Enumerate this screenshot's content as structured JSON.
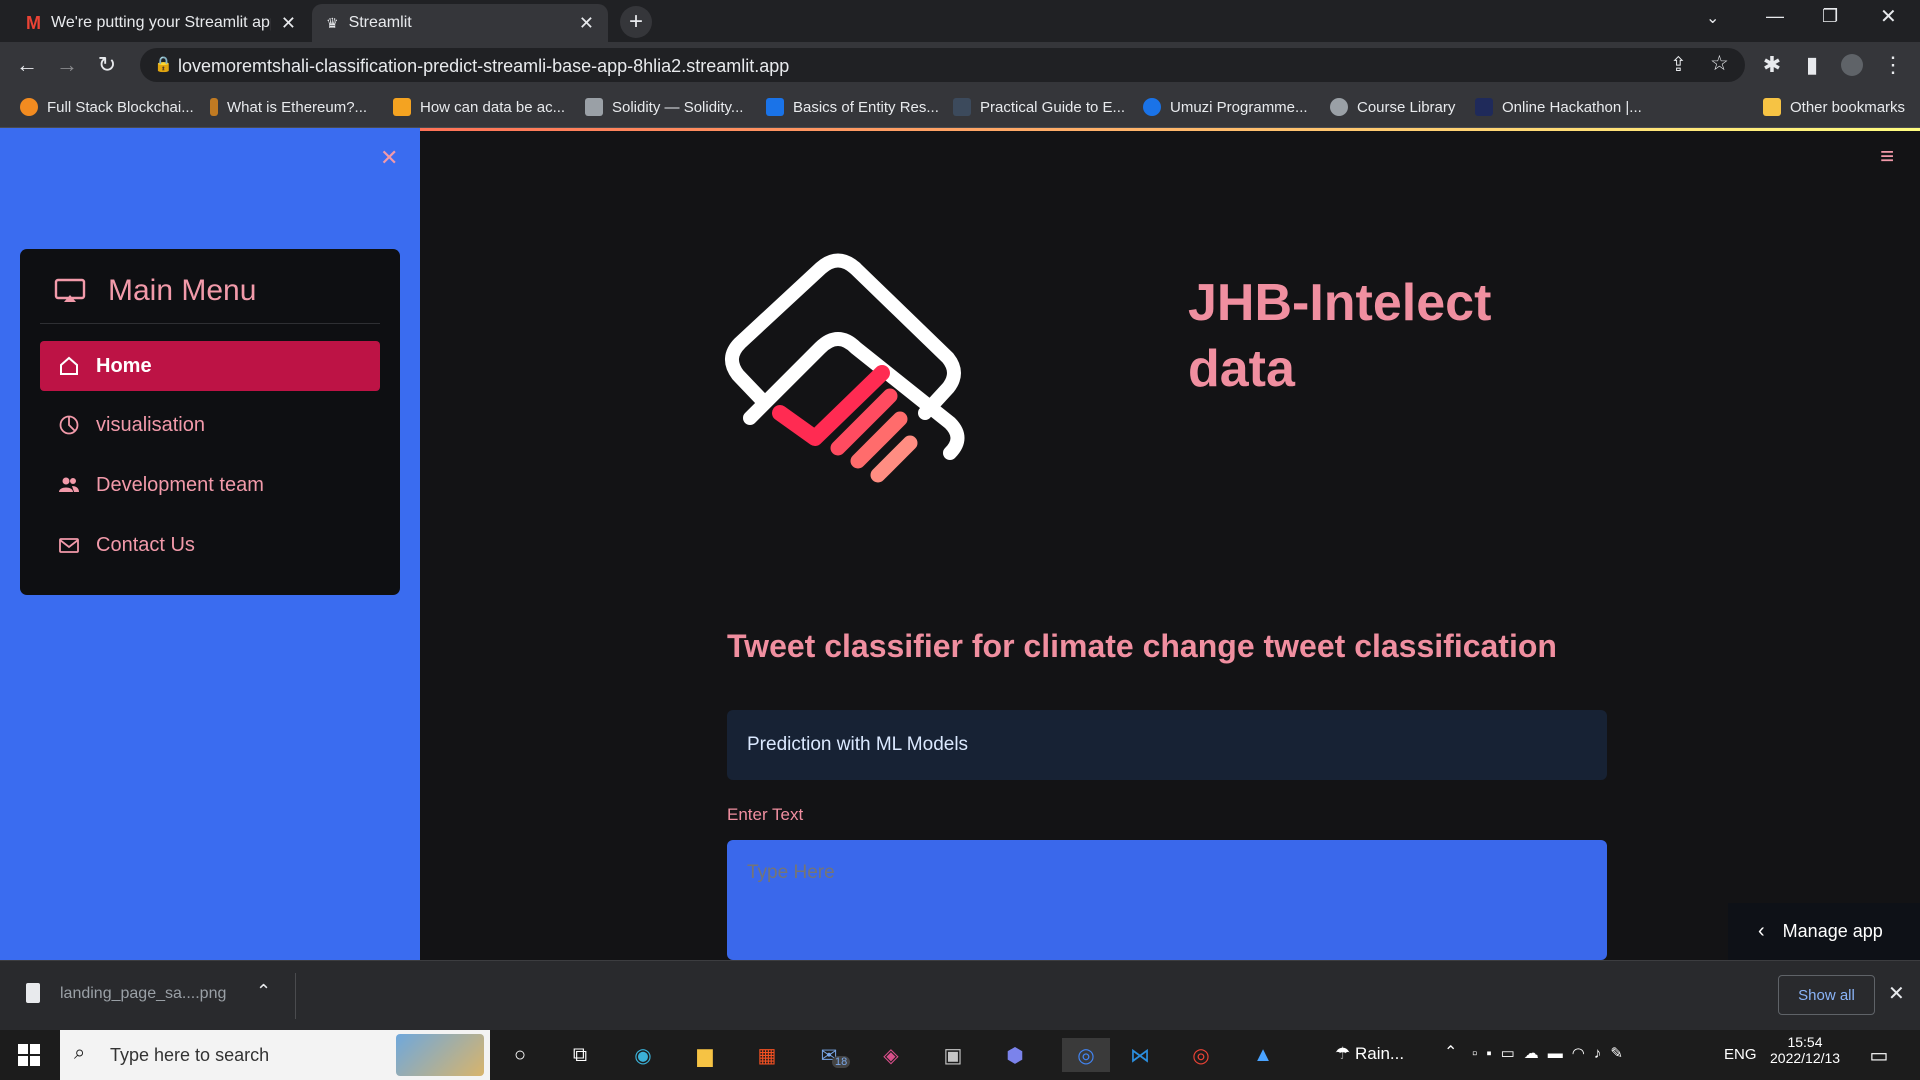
{
  "browser": {
    "tabs": [
      {
        "title": "We're putting your Streamlit app",
        "active": false
      },
      {
        "title": "Streamlit",
        "active": true
      }
    ],
    "url": "lovemoremtshali-classification-predict-streamli-base-app-8hlia2.streamlit.app",
    "bookmarks": [
      "Full Stack Blockchai...",
      "What is Ethereum?...",
      "How can data be ac...",
      "Solidity — Solidity...",
      "Basics of Entity Res...",
      "Practical Guide to E...",
      "Umuzi Programme...",
      "Course Library",
      "Online Hackathon |..."
    ],
    "other_bookmarks": "Other bookmarks"
  },
  "sidebar": {
    "menu_title": "Main Menu",
    "items": [
      {
        "label": "Home",
        "icon": "house-icon",
        "active": true
      },
      {
        "label": "visualisation",
        "icon": "pie-chart-icon",
        "active": false
      },
      {
        "label": "Development team",
        "icon": "people-icon",
        "active": false
      },
      {
        "label": "Contact Us",
        "icon": "envelope-icon",
        "active": false
      }
    ]
  },
  "main": {
    "title": "JHB-Intelect data",
    "title_line1": "JHB-Intelect",
    "title_line2": "data",
    "subtitle": "Tweet classifier for climate change tweet classification",
    "info": "Prediction with ML Models",
    "input_label": "Enter Text",
    "input_placeholder": "Type Here",
    "manage_app": "Manage app"
  },
  "download_bar": {
    "file": "landing_page_sa....png",
    "show_all": "Show all"
  },
  "taskbar": {
    "search_placeholder": "Type here to search",
    "weather": "Rain...",
    "language": "ENG",
    "time": "15:54",
    "date": "2022/12/13",
    "mail_badge": "18"
  },
  "colors": {
    "sidebar_bg": "#3a6cf0",
    "accent_pink": "#f08fa0",
    "active_item": "#bd1345",
    "app_bg": "#131315"
  }
}
